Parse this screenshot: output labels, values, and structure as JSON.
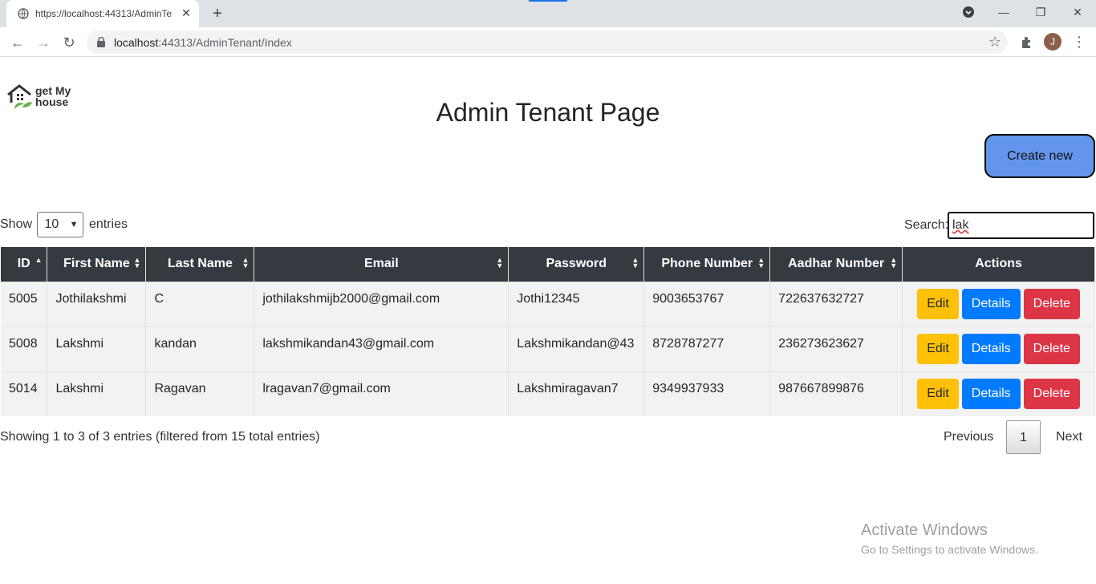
{
  "browser": {
    "tab_title": "https://localhost:44313/AdminTe",
    "url_host": "localhost",
    "url_rest": ":44313/AdminTenant/Index",
    "avatar_letter": "J"
  },
  "logo": {
    "line1": "get My",
    "line2": "house"
  },
  "page": {
    "title": "Admin Tenant Page",
    "create_label": "Create new"
  },
  "table_controls": {
    "show_label": "Show",
    "entries_value": "10",
    "entries_label": "entries",
    "search_label": "Search:",
    "search_value": "lak"
  },
  "table": {
    "headers": [
      "ID",
      "First Name",
      "Last Name",
      "Email",
      "Password",
      "Phone Number",
      "Aadhar Number",
      "Actions"
    ],
    "rows": [
      [
        "5005",
        "Jothilakshmi",
        "C",
        "jothilakshmijb2000@gmail.com",
        "Jothi12345",
        "9003653767",
        "722637632727"
      ],
      [
        "5008",
        "Lakshmi",
        "kandan",
        "lakshmikandan43@gmail.com",
        "Lakshmikandan@43",
        "8728787277",
        "236273623627"
      ],
      [
        "5014",
        "Lakshmi",
        "Ragavan",
        "lragavan7@gmail.com",
        "Lakshmiragavan7",
        "9349937933",
        "987667899876"
      ]
    ],
    "edit_label": "Edit",
    "details_label": "Details",
    "delete_label": "Delete"
  },
  "footer": {
    "info": "Showing 1 to 3 of 3 entries (filtered from 15 total entries)",
    "previous": "Previous",
    "current_page": "1",
    "next": "Next"
  },
  "watermark": {
    "line1": "Activate Windows",
    "line2": "Go to Settings to activate Windows."
  }
}
